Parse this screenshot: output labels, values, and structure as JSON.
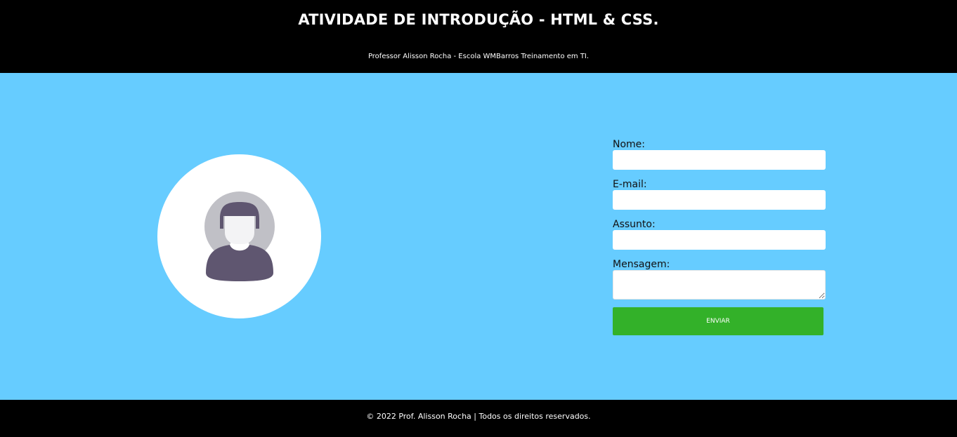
{
  "header": {
    "title": "ATIVIDADE DE INTRODUÇÃO - HTML & CSS.",
    "subtitle": "Professor Alisson Rocha - Escola WMBarros Treinamento em TI."
  },
  "avatar": {
    "icon": "user-avatar-icon"
  },
  "form": {
    "fields": [
      {
        "label": "Nome:",
        "value": "",
        "placeholder": ""
      },
      {
        "label": "E-mail:",
        "value": "",
        "placeholder": ""
      },
      {
        "label": "Assunto:",
        "value": "",
        "placeholder": ""
      },
      {
        "label": "Mensagem:",
        "value": "",
        "placeholder": ""
      }
    ],
    "submit_label": "ENVIAR"
  },
  "footer": {
    "text": "© 2022 Prof. Alisson Rocha | Todos os direitos reservados."
  },
  "colors": {
    "header_bg": "#000000",
    "main_bg": "#66ccff",
    "button_bg": "#33b129",
    "avatar_bg": "#ffffff"
  }
}
